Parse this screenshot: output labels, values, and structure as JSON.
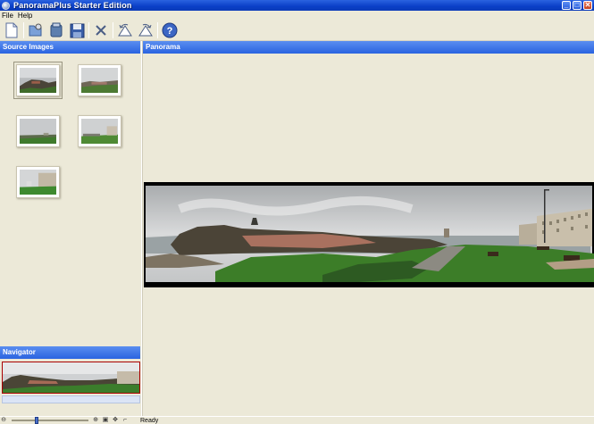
{
  "window": {
    "title": "PanoramaPlus Starter Edition"
  },
  "menu": [
    {
      "label": "File"
    },
    {
      "label": "Help"
    }
  ],
  "toolbar": {
    "buttons": [
      {
        "name": "new-icon"
      },
      {
        "name": "open-folder-icon"
      },
      {
        "name": "stitch-icon"
      },
      {
        "name": "save-icon"
      },
      {
        "name": "delete-icon"
      },
      {
        "name": "rotate-left-icon"
      },
      {
        "name": "rotate-right-icon"
      },
      {
        "name": "help-icon"
      }
    ]
  },
  "source_panel": {
    "title": "Source Images",
    "thumbnails": 5,
    "selected": 0
  },
  "panorama_panel": {
    "title": "Panorama"
  },
  "navigator": {
    "title": "Navigator"
  },
  "statusbar": {
    "status": "Ready"
  },
  "colors": {
    "header_blue": "#2a63e0",
    "bg": "#ece9d8",
    "navigator_frame": "#aa0000"
  }
}
